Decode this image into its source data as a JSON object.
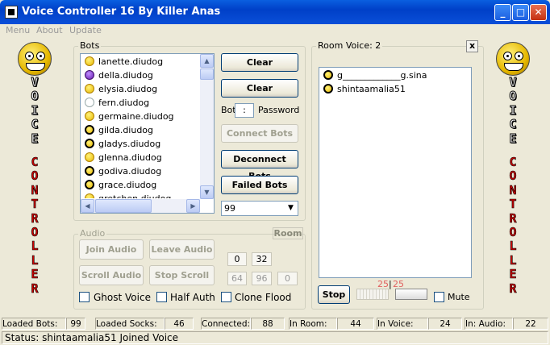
{
  "window": {
    "title": "Voice Controller 16 By Killer Anas",
    "buttons": {
      "minimize": "_",
      "maximize": "□",
      "close": "✕"
    }
  },
  "menu": [
    "Menu",
    "About",
    "Update"
  ],
  "side_text": {
    "line1": [
      "V",
      "O",
      "I",
      "C",
      "E"
    ],
    "line2": [
      "C",
      "O",
      "N",
      "T",
      "R",
      "O",
      "L",
      "L",
      "E",
      "R"
    ]
  },
  "bots": {
    "legend": "Bots",
    "items": [
      {
        "name": "lanette.diudog",
        "icon": "smiley-icon"
      },
      {
        "name": "della.diudog",
        "icon": "devil-icon"
      },
      {
        "name": "elysia.diudog",
        "icon": "smiley-icon"
      },
      {
        "name": "fern.diudog",
        "icon": "offline-icon"
      },
      {
        "name": "germaine.diudog",
        "icon": "smiley-icon"
      },
      {
        "name": "gilda.diudog",
        "icon": "headset-icon"
      },
      {
        "name": "gladys.diudog",
        "icon": "headset-icon"
      },
      {
        "name": "glenna.diudog",
        "icon": "smiley-icon"
      },
      {
        "name": "godiva.diudog",
        "icon": "headset-icon"
      },
      {
        "name": "grace.diudog",
        "icon": "headset-icon"
      },
      {
        "name": "gretchen.diudog",
        "icon": "smiley-icon"
      }
    ],
    "clear1": "Clear",
    "clear2": "Clear",
    "bot_label": "Bot",
    "separator": ":",
    "password_label": "Password",
    "connect": "Connect Bots",
    "disconnect": "Deconnect Bots",
    "failed": "Failed Bots",
    "dropdown_value": "99"
  },
  "audio": {
    "legend": "Audio",
    "room_label": "Room",
    "join": "Join Audio",
    "leave": "Leave Audio",
    "scroll": "Scroll Audio",
    "stop_scroll": "Stop Scroll",
    "nums": [
      "0",
      "32",
      "64",
      "96",
      "0"
    ],
    "ghost_voice": "Ghost Voice",
    "half_auth": "Half Auth",
    "clone_flood": "Clone Flood"
  },
  "room_voice": {
    "legend": "Room Voice: 2",
    "close": "x",
    "users": [
      "g_____________g.sina",
      "shintaamalia51"
    ],
    "stop": "Stop",
    "counter_a": "25",
    "counter_b": "25",
    "mute": "Mute"
  },
  "status": {
    "cells": [
      {
        "label": "Loaded Bots:",
        "value": "99"
      },
      {
        "label": "Loaded Socks:",
        "value": "46"
      },
      {
        "label": "Connected:",
        "value": "88"
      },
      {
        "label": "In Room:",
        "value": "44"
      },
      {
        "label": "In Voice:",
        "value": "24"
      },
      {
        "label": "In: Audio:",
        "value": "22"
      }
    ],
    "message": "Status: shintaamalia51 Joined Voice"
  }
}
